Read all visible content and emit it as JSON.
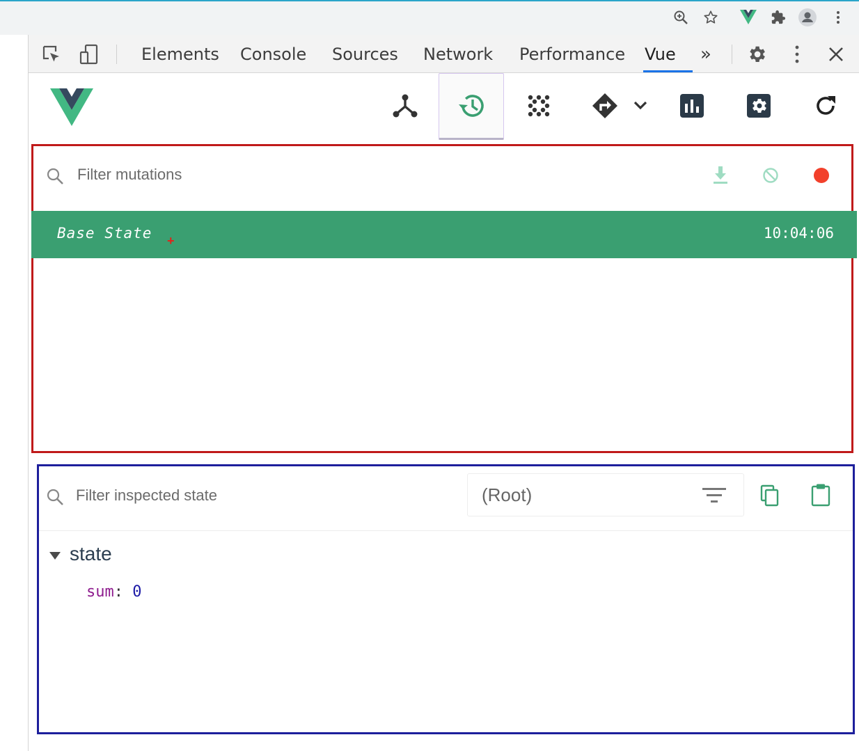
{
  "devtools": {
    "tabs": [
      {
        "label": "Elements"
      },
      {
        "label": "Console"
      },
      {
        "label": "Sources"
      },
      {
        "label": "Network"
      },
      {
        "label": "Performance"
      },
      {
        "label": "Vue"
      }
    ],
    "more_label": "»",
    "active_tab": "Vue"
  },
  "vue_toolbar": {
    "active_tool": "timeline"
  },
  "mutations": {
    "filter_placeholder": "Filter mutations",
    "rows": [
      {
        "label": "Base State",
        "time": "10:04:06"
      }
    ]
  },
  "state_inspector": {
    "filter_placeholder": "Filter inspected state",
    "root_label": "(Root)",
    "section": "state",
    "props": [
      {
        "key": "sum",
        "value": "0"
      }
    ]
  },
  "colors": {
    "vue_green": "#42b883",
    "row_green": "#3a9f71",
    "record_red": "#f2402b",
    "tab_underline": "#1a73e8"
  }
}
